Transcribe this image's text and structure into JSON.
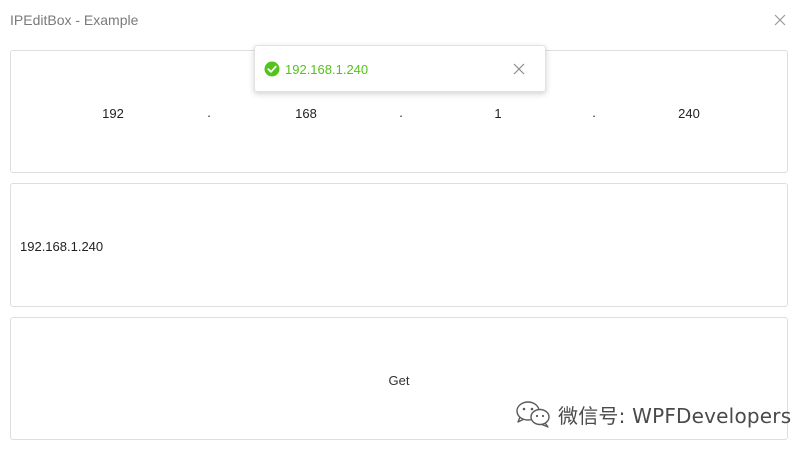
{
  "window": {
    "title": "IPEditBox - Example"
  },
  "ip_edit": {
    "segments": [
      "192",
      "168",
      "1",
      "240"
    ],
    "separators": [
      ".",
      ".",
      "."
    ]
  },
  "text_box": {
    "value": "192.168.1.240"
  },
  "get_button": {
    "label": "Get"
  },
  "toast": {
    "message": "192.168.1.240",
    "type": "success",
    "icon": "check-circle-icon",
    "color": "#52c41a"
  },
  "watermark": {
    "text": "微信号: WPFDevelopers",
    "icon": "wechat-logo-icon"
  },
  "colors": {
    "border": "#dedede",
    "success": "#52c41a",
    "title": "#7a7a7a"
  }
}
